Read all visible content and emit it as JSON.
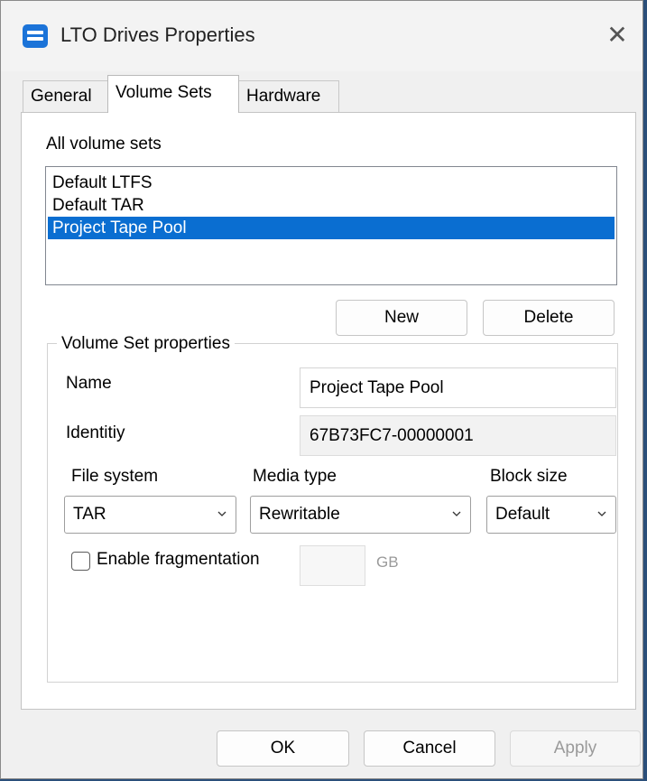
{
  "window": {
    "title": "LTO Drives Properties",
    "close_glyph": "✕"
  },
  "tabs": [
    {
      "label": "General",
      "active": false
    },
    {
      "label": "Volume Sets",
      "active": true
    },
    {
      "label": "Hardware",
      "active": false
    }
  ],
  "volume_sets": {
    "list_label": "All volume sets",
    "items": [
      {
        "label": "Default LTFS",
        "selected": false
      },
      {
        "label": "Default TAR",
        "selected": false
      },
      {
        "label": "Project Tape Pool",
        "selected": true
      }
    ],
    "new_label": "New",
    "delete_label": "Delete"
  },
  "properties": {
    "group_label": "Volume Set properties",
    "name_label": "Name",
    "name_value": "Project Tape Pool",
    "identity_label": "Identitiy",
    "identity_value": "67B73FC7-00000001",
    "file_system_label": "File system",
    "file_system_value": "TAR",
    "media_type_label": "Media type",
    "media_type_value": "Rewritable",
    "block_size_label": "Block size",
    "block_size_value": "Default",
    "fragmentation_label": "Enable fragmentation",
    "fragmentation_checked": false,
    "fragmentation_value": "",
    "fragmentation_unit": "GB"
  },
  "footer": {
    "ok_label": "OK",
    "cancel_label": "Cancel",
    "apply_label": "Apply"
  },
  "colors": {
    "selection": "#0a6ed1",
    "app_icon": "#1b73d8"
  }
}
